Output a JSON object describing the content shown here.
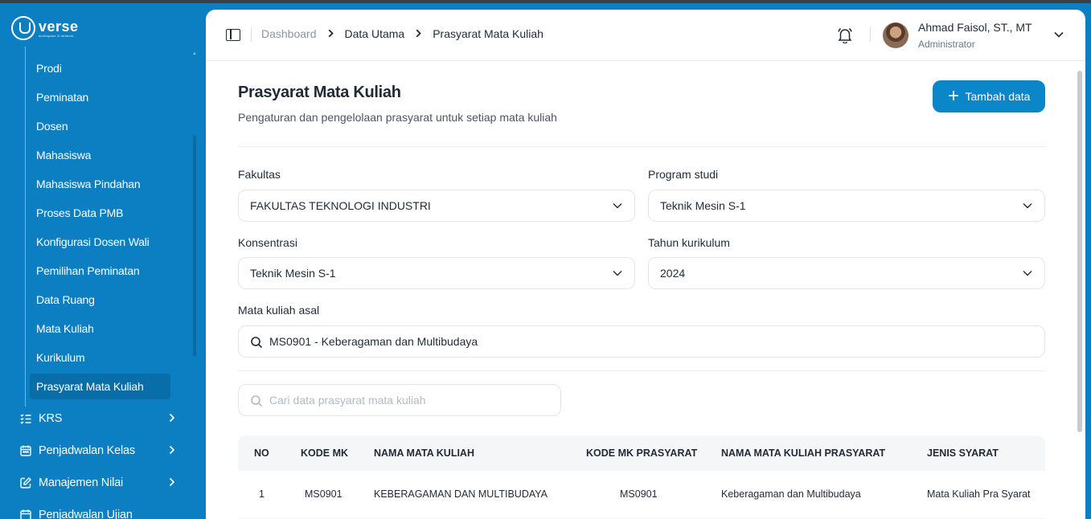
{
  "sidebar": {
    "logo_text": "verse",
    "logo_sub": "workspace & network",
    "sub_items": [
      {
        "label": "Prodi",
        "active": false
      },
      {
        "label": "Peminatan",
        "active": false
      },
      {
        "label": "Dosen",
        "active": false
      },
      {
        "label": "Mahasiswa",
        "active": false
      },
      {
        "label": "Mahasiswa Pindahan",
        "active": false
      },
      {
        "label": "Proses Data PMB",
        "active": false
      },
      {
        "label": "Konfigurasi Dosen Wali",
        "active": false
      },
      {
        "label": "Pemilihan Peminatan",
        "active": false
      },
      {
        "label": "Data Ruang",
        "active": false
      },
      {
        "label": "Mata Kuliah",
        "active": false
      },
      {
        "label": "Kurikulum",
        "active": false
      },
      {
        "label": "Prasyarat Mata Kuliah",
        "active": true
      }
    ],
    "groups": [
      {
        "label": "KRS",
        "icon": "list-check-icon"
      },
      {
        "label": "Penjadwalan Kelas",
        "icon": "calendar-icon"
      },
      {
        "label": "Manajemen Nilai",
        "icon": "edit-icon"
      },
      {
        "label": "Penjadwalan Ujian",
        "icon": "calendar-icon"
      }
    ]
  },
  "header": {
    "breadcrumb": [
      "Dashboard",
      "Data Utama",
      "Prasyarat Mata Kuliah"
    ],
    "user_name": "Ahmad Faisol, ST., MT",
    "user_role": "Administrator"
  },
  "page": {
    "title": "Prasyarat Mata Kuliah",
    "subtitle": "Pengaturan dan pengelolaan prasyarat untuk setiap mata kuliah",
    "add_button": "Tambah data"
  },
  "filters": {
    "fakultas_label": "Fakultas",
    "fakultas_value": "FAKULTAS TEKNOLOGI INDUSTRI",
    "prodi_label": "Program studi",
    "prodi_value": "Teknik Mesin S-1",
    "konsentrasi_label": "Konsentrasi",
    "konsentrasi_value": "Teknik Mesin S-1",
    "tahun_label": "Tahun kurikulum",
    "tahun_value": "2024",
    "matkul_label": "Mata kuliah asal",
    "matkul_value": "MS0901 - Keberagaman dan Multibudaya"
  },
  "search": {
    "placeholder": "Cari data prasyarat mata kuliah"
  },
  "table": {
    "headers": [
      "NO",
      "KODE MK",
      "NAMA MATA KULIAH",
      "KODE MK PRASYARAT",
      "NAMA MATA KULIAH PRASYARAT",
      "JENIS SYARAT"
    ],
    "rows": [
      [
        "1",
        "MS0901",
        "KEBERAGAMAN DAN MULTIBUDAYA",
        "MS0901",
        "Keberagaman dan Multibudaya",
        "Mata Kuliah Pra Syarat"
      ]
    ]
  },
  "colors": {
    "sidebar_bg": "#0b7fc1",
    "accent": "#0b86c8",
    "active_item": "#096ea7"
  }
}
